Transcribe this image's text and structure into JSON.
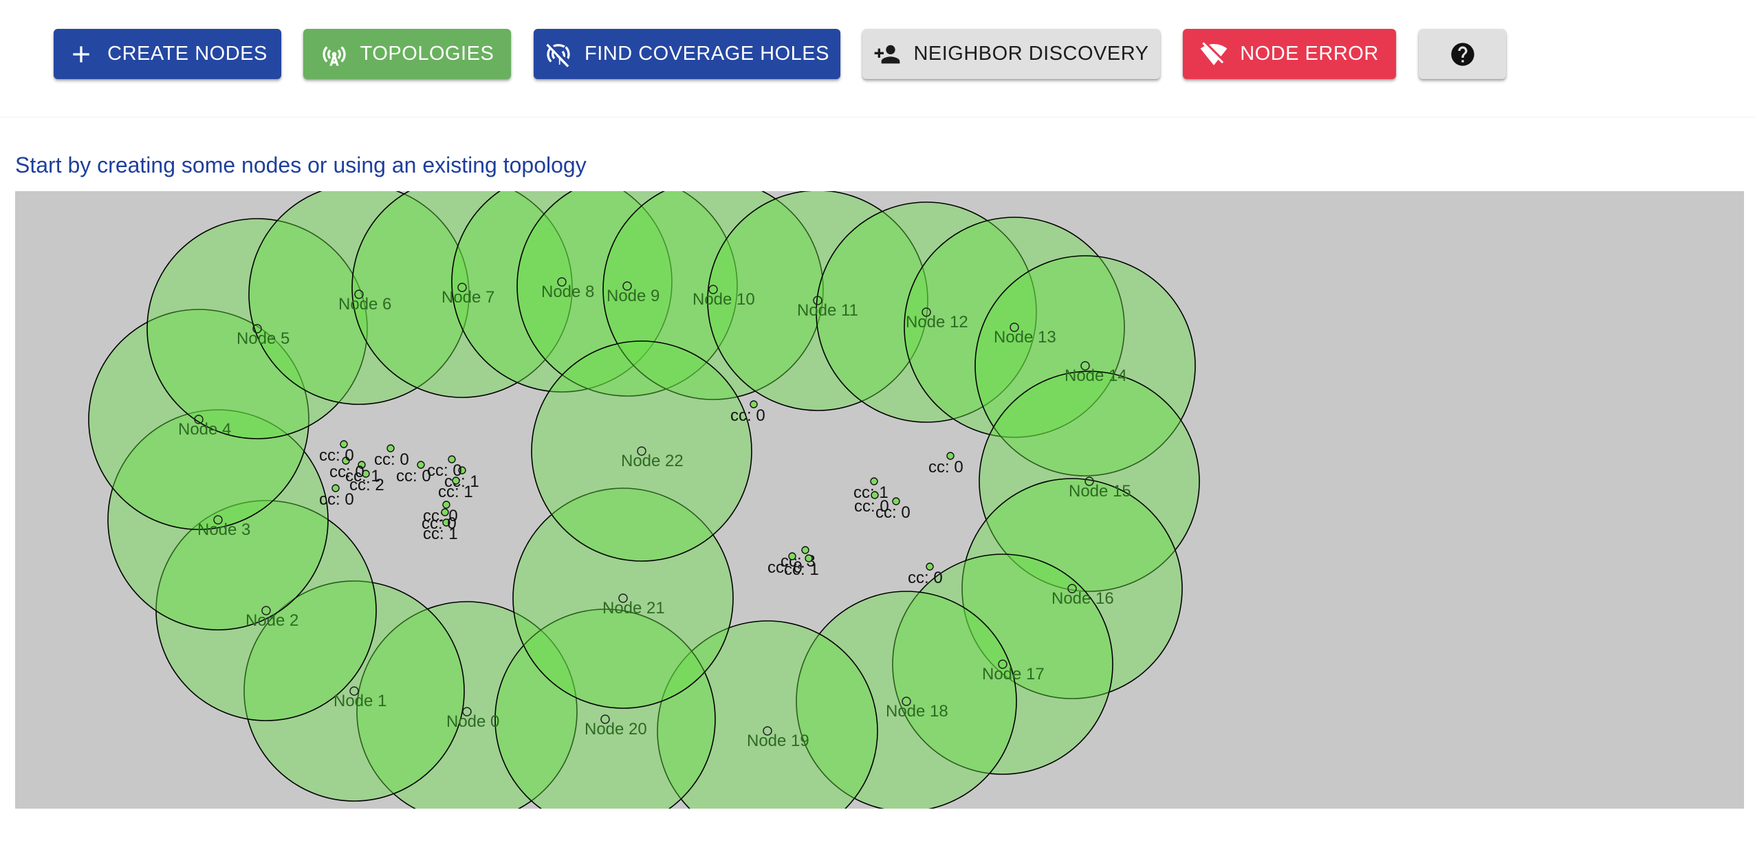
{
  "toolbar": {
    "create_nodes": {
      "label": "CREATE NODES",
      "icon": "plus-icon",
      "bg": "#2447a2",
      "fg": "#ffffff"
    },
    "topologies": {
      "label": "TOPOLOGIES",
      "icon": "antenna-icon",
      "bg": "#69b15f",
      "fg": "#ffffff"
    },
    "find_coverage_holes": {
      "label": "FIND COVERAGE HOLES",
      "icon": "signal-off-icon",
      "bg": "#2447a2",
      "fg": "#ffffff"
    },
    "neighbor_discovery": {
      "label": "NEIGHBOR DISCOVERY",
      "icon": "person-add-icon",
      "bg": "#e0e0e0",
      "fg": "#1c1c1c"
    },
    "node_error": {
      "label": "NODE ERROR",
      "icon": "wifi-off-icon",
      "bg": "#e8384f",
      "fg": "#ffffff"
    },
    "help": {
      "label": "",
      "icon": "help-icon",
      "bg": "#e0e0e0",
      "fg": "#111111"
    }
  },
  "subtitle": "Start by creating some nodes or using an existing topology",
  "colors": {
    "canvas_bg": "#c8c8c8",
    "coverage_fill": "#66dd44",
    "coverage_stroke": "#000000",
    "label_color": "#2e6a22",
    "cc_label_color": "#111111"
  },
  "network": {
    "nodes": [
      {
        "label": "Node 0"
      },
      {
        "label": "Node 1"
      },
      {
        "label": "Node 2"
      },
      {
        "label": "Node 3"
      },
      {
        "label": "Node 4"
      },
      {
        "label": "Node 5"
      },
      {
        "label": "Node 6"
      },
      {
        "label": "Node 7"
      },
      {
        "label": "Node 8"
      },
      {
        "label": "Node 9"
      },
      {
        "label": "Node 10"
      },
      {
        "label": "Node 11"
      },
      {
        "label": "Node 12"
      },
      {
        "label": "Node 13"
      },
      {
        "label": "Node 14"
      },
      {
        "label": "Node 15"
      },
      {
        "label": "Node 16"
      },
      {
        "label": "Node 17"
      },
      {
        "label": "Node 18"
      },
      {
        "label": "Node 19"
      },
      {
        "label": "Node 20"
      },
      {
        "label": "Node 21"
      },
      {
        "label": "Node 22"
      }
    ],
    "coverage_points": [
      {
        "label": "cc: 0"
      },
      {
        "label": "cc: 0"
      },
      {
        "label": "cc: 0"
      },
      {
        "label": "cc: 1"
      },
      {
        "label": "cc: 2"
      },
      {
        "label": "cc: 0"
      },
      {
        "label": "cc: 0"
      },
      {
        "label": "cc: 1"
      },
      {
        "label": "cc: 1"
      },
      {
        "label": "cc: 1"
      },
      {
        "label": "cc: 0"
      },
      {
        "label": "cc: 0"
      },
      {
        "label": "cc: 1"
      },
      {
        "label": "cc: 0"
      },
      {
        "label": "cc: 0"
      },
      {
        "label": "cc: 0"
      },
      {
        "label": "cc: 3"
      },
      {
        "label": "cc: 1"
      },
      {
        "label": "cc: 0"
      },
      {
        "label": "cc: 0"
      },
      {
        "label": "cc: 0"
      },
      {
        "label": "cc: 0"
      }
    ]
  }
}
